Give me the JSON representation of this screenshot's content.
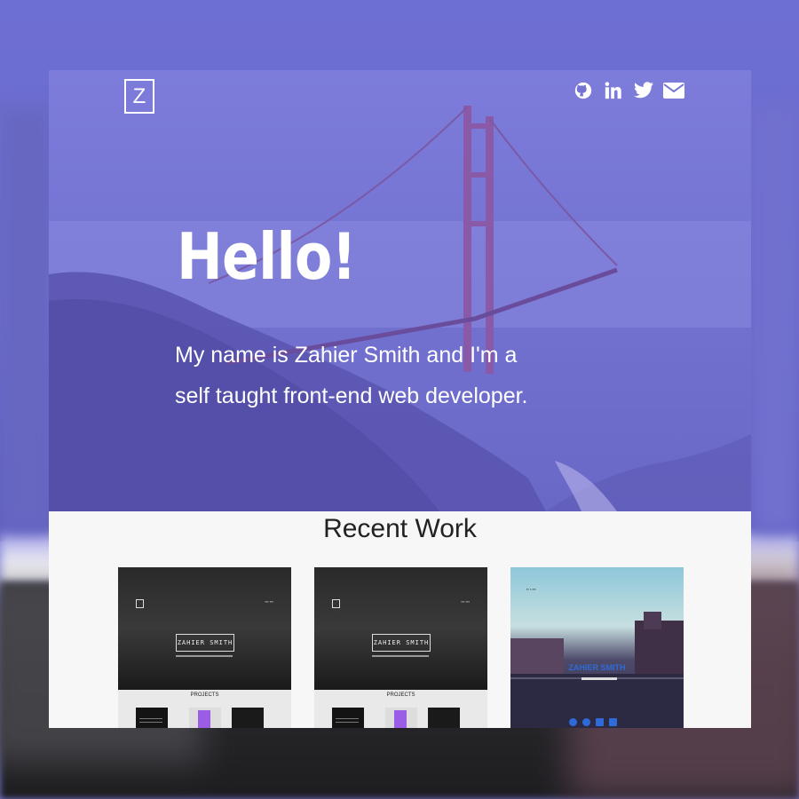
{
  "header": {
    "logo_text": "Z",
    "social_icons": [
      "github-icon",
      "linkedin-icon",
      "twitter-icon",
      "envelope-icon"
    ]
  },
  "hero": {
    "title": "Hello!",
    "intro": "My name is Zahier Smith and I'm a self taught front-end web developer."
  },
  "recent_work": {
    "title": "Recent Work",
    "projects": [
      {
        "banner_text": "ZAHIER SMITH",
        "section_label": "PROJECTS"
      },
      {
        "banner_text": "ZAHIER SMITH",
        "section_label": "PROJECTS"
      },
      {
        "banner_text": "ZAHIER SMITH"
      }
    ]
  },
  "colors": {
    "hero_overlay": "#7473d2",
    "text_light": "#ffffff",
    "section_bg": "#f7f7f8",
    "accent_blue": "#2f6bd8"
  }
}
